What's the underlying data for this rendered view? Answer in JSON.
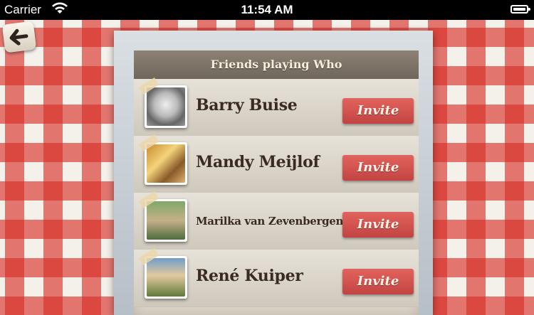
{
  "status_bar": {
    "carrier": "Carrier",
    "time": "11:54 AM"
  },
  "header": {
    "title": "Friends playing Who"
  },
  "friends": [
    {
      "name": "Barry Buise",
      "invite_label": "Invite"
    },
    {
      "name": "Mandy Meijlof",
      "invite_label": "Invite"
    },
    {
      "name": "Marilka van Zevenbergen",
      "invite_label": "Invite"
    },
    {
      "name": "René Kuiper",
      "invite_label": "Invite"
    }
  ],
  "icons": {
    "back": "back-arrow-icon",
    "wifi": "wifi-icon",
    "battery": "battery-icon"
  },
  "colors": {
    "tablecloth_red": "#d72c24",
    "invite_button": "#d15350",
    "header_bar": "#7d7468",
    "name_text": "#3a2b22"
  }
}
